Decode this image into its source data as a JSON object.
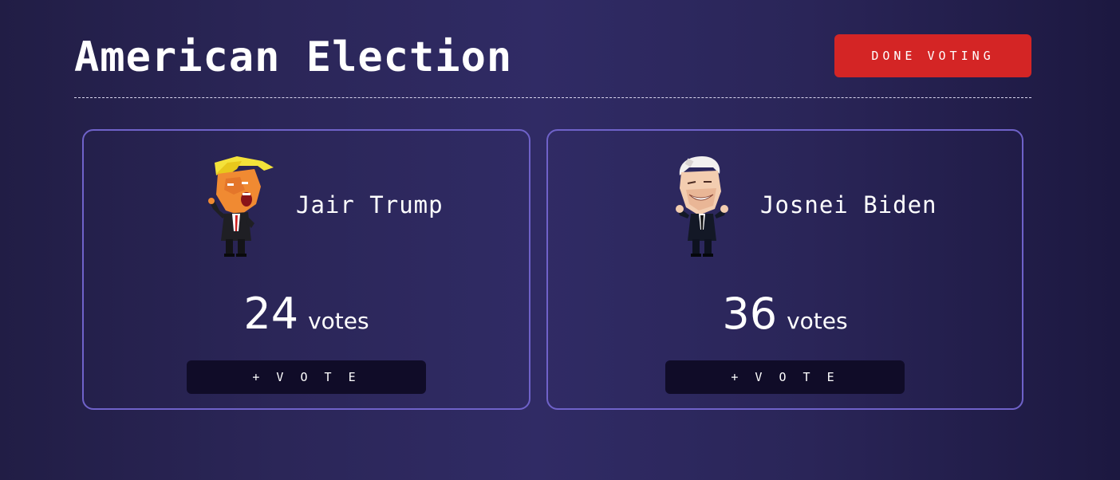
{
  "page": {
    "title": "American Election"
  },
  "header": {
    "done_button_label": "Done Voting"
  },
  "candidates": [
    {
      "name": "Jair Trump",
      "votes": "24",
      "votes_label": "votes",
      "vote_button_label": "+ V O T E",
      "avatar_icon": "trump-caricature-icon"
    },
    {
      "name": "Josnei Biden",
      "votes": "36",
      "votes_label": "votes",
      "vote_button_label": "+ V O T E",
      "avatar_icon": "biden-caricature-icon"
    }
  ],
  "colors": {
    "background": "#2b2658",
    "accent_red": "#d42525",
    "card_border": "#6f62c9",
    "vote_button_bg": "#100c28"
  }
}
